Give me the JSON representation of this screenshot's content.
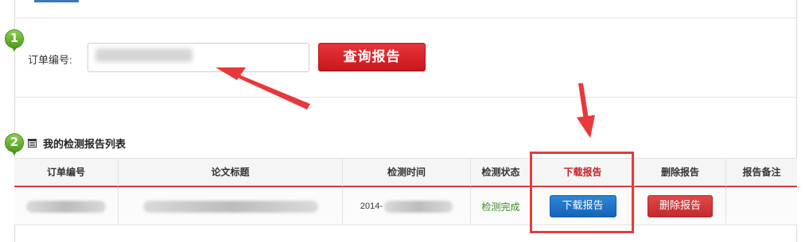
{
  "search": {
    "step_number": "1",
    "order_label": "订单编号:",
    "order_value": "",
    "query_button": "查询报告"
  },
  "list": {
    "step_number": "2",
    "title": "我的检测报告列表",
    "columns": [
      "订单编号",
      "论文标题",
      "检测时间",
      "检测状态",
      "下载报告",
      "删除报告",
      "报告备注"
    ],
    "rows": [
      {
        "order_no": "",
        "paper_title": "",
        "check_time_prefix": "2014-",
        "status": "检测完成",
        "download_button": "下载报告",
        "delete_button": "删除报告",
        "note": ""
      }
    ]
  },
  "colors": {
    "accent_red": "#d93a3a",
    "button_blue": "#1464b9",
    "marker_green": "#5aa527",
    "status_green": "#3a8b20"
  },
  "icons": {
    "step_marker": "map-pin-icon",
    "list_title_icon": "calendar-icon"
  }
}
